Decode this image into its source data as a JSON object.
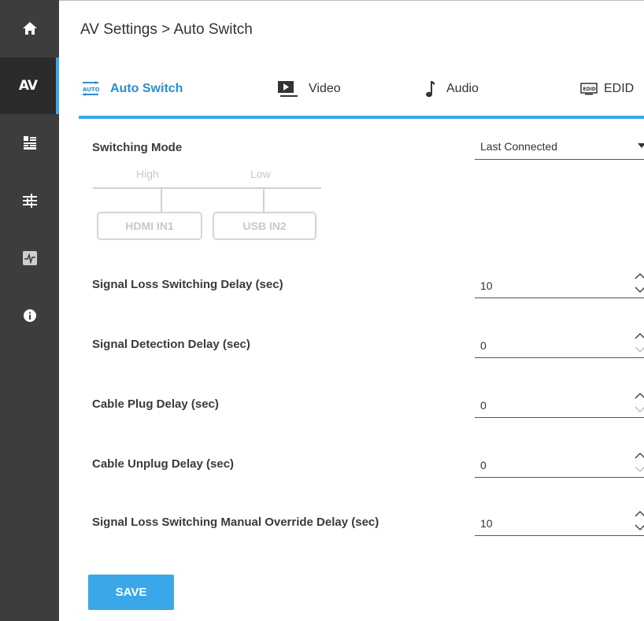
{
  "sidebar": {
    "items": [
      {
        "name": "home-icon"
      },
      {
        "name": "av",
        "label": "AV"
      },
      {
        "name": "matrix-icon"
      },
      {
        "name": "sliders-icon"
      },
      {
        "name": "pulse-icon"
      },
      {
        "name": "info-icon"
      }
    ],
    "accent_color": "#3aa7e8",
    "background_color": "#3d3d3d"
  },
  "header": {
    "title": "AV Settings > Auto Switch"
  },
  "tabs": [
    {
      "label": "Auto Switch",
      "icon": "auto-switch-icon",
      "active": true
    },
    {
      "label": "Video",
      "icon": "video-icon",
      "active": false
    },
    {
      "label": "Audio",
      "icon": "music-note-icon",
      "active": false
    },
    {
      "label": "EDID",
      "icon": "edid-icon",
      "active": false
    }
  ],
  "switching_mode": {
    "label": "Switching Mode",
    "selected": "Last Connected",
    "priority": {
      "high_label": "High",
      "low_label": "Low",
      "inputs": [
        "HDMI IN1",
        "USB IN2"
      ]
    }
  },
  "settings": [
    {
      "label": "Signal Loss Switching Delay (sec)",
      "value": "10"
    },
    {
      "label": "Signal Detection Delay (sec)",
      "value": "0"
    },
    {
      "label": "Cable Plug Delay (sec)",
      "value": "0"
    },
    {
      "label": "Cable Unplug Delay (sec)",
      "value": "0"
    },
    {
      "label": "Signal Loss Switching Manual Override Delay (sec)",
      "value": "10"
    }
  ],
  "save_label": "SAVE"
}
